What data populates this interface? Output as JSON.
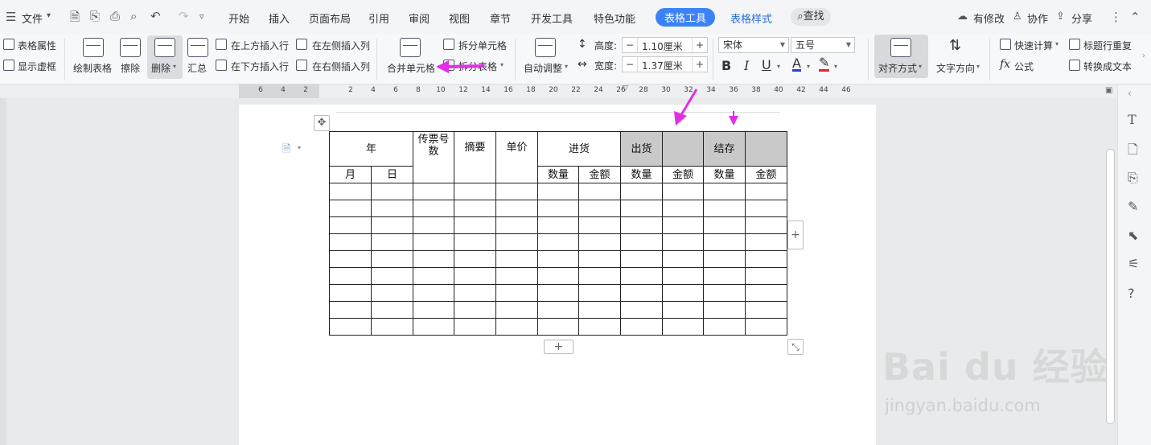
{
  "menubar": {
    "file_label": "文件",
    "tabs": [
      "开始",
      "插入",
      "页面布局",
      "引用",
      "审阅",
      "视图",
      "章节",
      "开发工具",
      "特色功能",
      "表格工具",
      "表格样式"
    ],
    "search_label": "查找",
    "right": [
      "有修改",
      "协作",
      "分享"
    ]
  },
  "ribbon": {
    "table_props": "表格属性",
    "show_grid": "显示虚框",
    "draw_table": "绘制表格",
    "erase": "擦除",
    "delete": "删除",
    "summary": "汇总",
    "insert_above": "在上方插入行",
    "insert_below": "在下方插入行",
    "insert_left": "在左侧插入列",
    "insert_right": "在右侧插入列",
    "merge_cells": "合并单元格",
    "split_cells": "拆分单元格",
    "split_table": "拆分表格",
    "auto_fit": "自动调整",
    "height_label": "高度:",
    "height_value": "1.10厘米",
    "width_label": "宽度:",
    "width_value": "1.37厘米",
    "font_name": "宋体",
    "font_size": "五号",
    "align": "对齐方式",
    "text_dir": "文字方向",
    "quick_calc": "快速计算",
    "formula": "公式",
    "repeat_header": "标题行重复",
    "convert_text": "转换成文本"
  },
  "ruler": {
    "ticks": [
      "6",
      "4",
      "2",
      "2",
      "4",
      "6",
      "8",
      "10",
      "12",
      "14",
      "16",
      "18",
      "20",
      "22",
      "24",
      "26",
      "28",
      "30",
      "32",
      "34",
      "36",
      "38",
      "40",
      "42",
      "44",
      "46"
    ]
  },
  "table": {
    "header1": [
      "年",
      "传票号数",
      "摘要",
      "单价",
      "进货",
      "出货",
      "",
      "结存",
      ""
    ],
    "header2": [
      "月",
      "日",
      "",
      "",
      "",
      "数量",
      "金额",
      "数量",
      "金额",
      "数量",
      "金额"
    ],
    "empty_rows": 9
  },
  "watermark": {
    "logo": "Bai du 经验",
    "url": "jingyan.baidu.com"
  },
  "colors": {
    "accent": "#3b82f6",
    "arrow": "#e32ee8",
    "gray_cell": "#c9c9c9"
  }
}
